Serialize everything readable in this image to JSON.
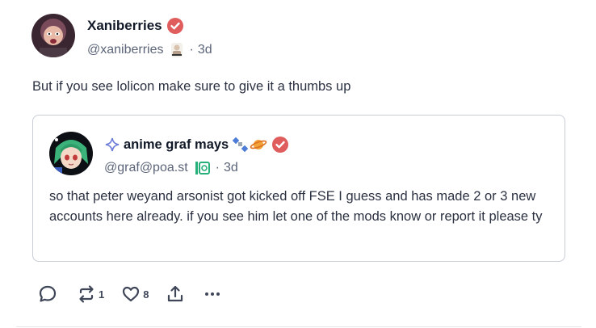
{
  "author": {
    "display_name": "Xaniberries",
    "handle": "@xaniberries",
    "time": "3d",
    "separator": "·"
  },
  "post": {
    "text": "But if you see lolicon make sure to give it a thumbs up"
  },
  "quote": {
    "display_name": "anime graf mays",
    "handle": "@graf@poa.st",
    "time": "3d",
    "separator": "·",
    "text": "so that peter weyand arsonist got kicked off FSE I guess and has made 2 or 3 new accounts here already. if you see him let one of the mods know or report it please ty"
  },
  "actions": {
    "reply_count": "",
    "repost_count": "1",
    "like_count": "8"
  },
  "colors": {
    "verified": "#e05d5d",
    "text": "#2b3141",
    "muted": "#5b6478",
    "border": "#c8cdd6",
    "icon": "#3f4658"
  },
  "icons": [
    "verified-badge-icon",
    "emoji-icon",
    "reply-icon",
    "repost-icon",
    "like-icon",
    "share-icon",
    "more-icon"
  ]
}
